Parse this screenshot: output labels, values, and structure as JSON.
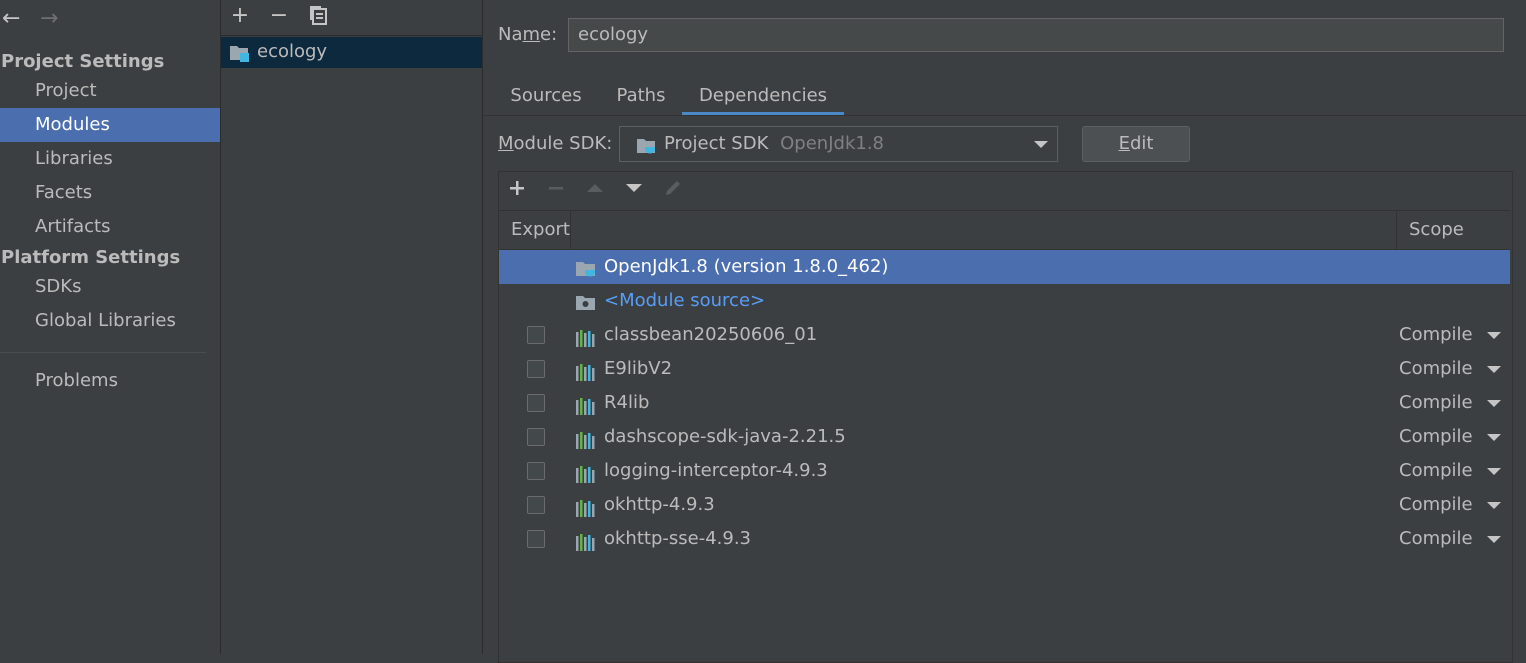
{
  "nav": {
    "back": "←",
    "forward": "→",
    "sections": [
      {
        "title": "Project Settings",
        "items": [
          "Project",
          "Modules",
          "Libraries",
          "Facets",
          "Artifacts"
        ]
      },
      {
        "title": "Platform Settings",
        "items": [
          "SDKs",
          "Global Libraries"
        ]
      }
    ],
    "problems": "Problems",
    "selected": "Modules"
  },
  "module_list": {
    "toolbar": {
      "add": "+",
      "remove": "−"
    },
    "modules": [
      "ecology"
    ]
  },
  "module": {
    "name_label_pre": "Na",
    "name_label_mn": "m",
    "name_label_post": "e:",
    "name_value": "ecology",
    "tabs": [
      "Sources",
      "Paths",
      "Dependencies"
    ],
    "active_tab": "Dependencies",
    "sdk_label_pre": "",
    "sdk_label_m": "M",
    "sdk_label_post": "odule SDK:",
    "sdk_value": "Project SDK",
    "sdk_hint": "OpenJdk1.8",
    "edit_pre": "",
    "edit_mn": "E",
    "edit_post": "dit"
  },
  "dependencies": {
    "columns": {
      "export": "Export",
      "scope": "Scope"
    },
    "rows": [
      {
        "name": "OpenJdk1.8 (version 1.8.0_462)",
        "type": "sdk",
        "selected": true
      },
      {
        "name": "<Module source>",
        "type": "source"
      },
      {
        "name": "classbean20250606_01",
        "type": "lib",
        "scope": "Compile"
      },
      {
        "name": "E9libV2",
        "type": "lib",
        "scope": "Compile"
      },
      {
        "name": "R4lib",
        "type": "lib",
        "scope": "Compile"
      },
      {
        "name": "dashscope-sdk-java-2.21.5",
        "type": "lib",
        "scope": "Compile"
      },
      {
        "name": "logging-interceptor-4.9.3",
        "type": "lib",
        "scope": "Compile"
      },
      {
        "name": "okhttp-4.9.3",
        "type": "lib",
        "scope": "Compile"
      },
      {
        "name": "okhttp-sse-4.9.3",
        "type": "lib",
        "scope": "Compile"
      }
    ]
  },
  "colors": {
    "selection": "#4b6eaf",
    "module_link": "#589df6",
    "tab_underline": "#4a88c7"
  }
}
